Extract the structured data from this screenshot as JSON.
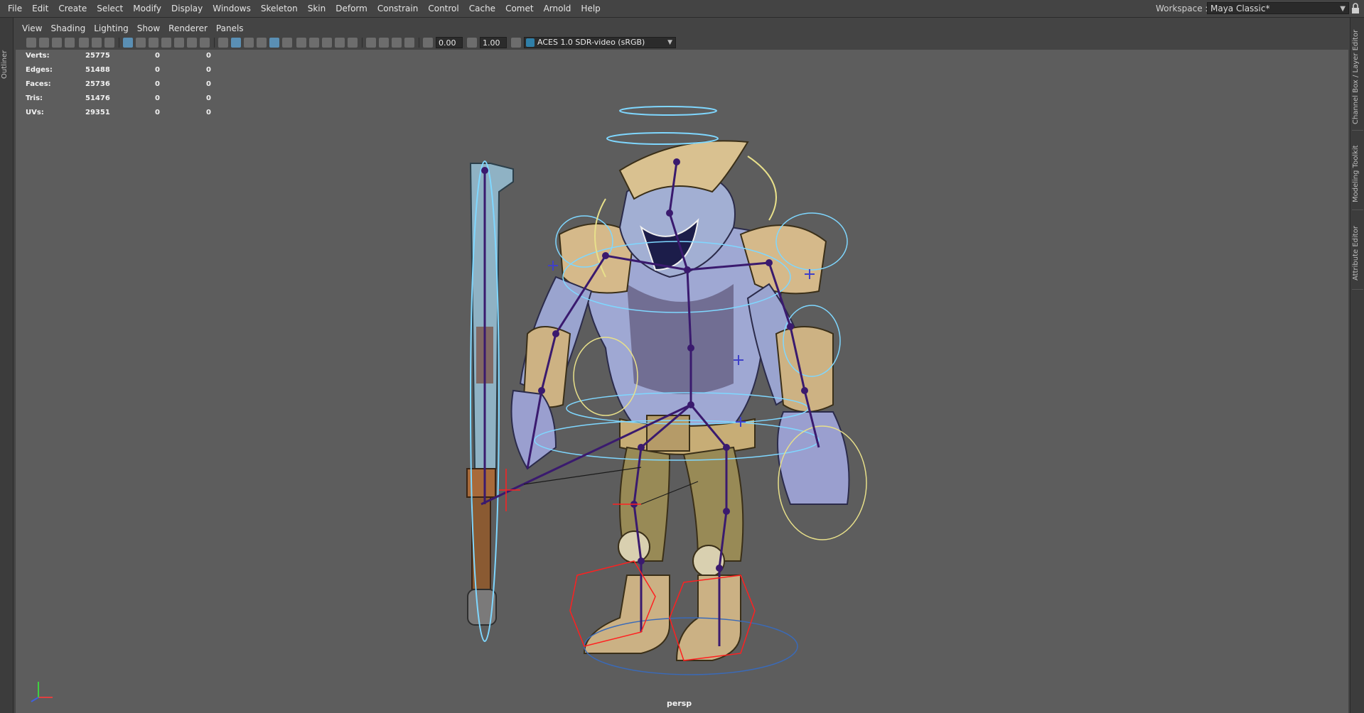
{
  "menubar": {
    "items": [
      "File",
      "Edit",
      "Create",
      "Select",
      "Modify",
      "Display",
      "Windows",
      "Skeleton",
      "Skin",
      "Deform",
      "Constrain",
      "Control",
      "Cache",
      "Comet",
      "Arnold",
      "Help"
    ],
    "workspace_label": "Workspace :",
    "workspace_value": "Maya Classic*"
  },
  "side_panels": {
    "left": [
      "Outliner"
    ],
    "right": [
      "Channel Box / Layer Editor",
      "Modeling Toolkit",
      "Attribute Editor"
    ]
  },
  "panel_menu": [
    "View",
    "Shading",
    "Lighting",
    "Show",
    "Renderer",
    "Panels"
  ],
  "toolbar": {
    "gamma_value": "0.00",
    "exposure_value": "1.00",
    "colorspace": "ACES 1.0 SDR-video (sRGB)"
  },
  "hud": {
    "rows": [
      {
        "label": "Verts:",
        "v1": "25775",
        "v2": "0",
        "v3": "0"
      },
      {
        "label": "Edges:",
        "v1": "51488",
        "v2": "0",
        "v3": "0"
      },
      {
        "label": "Faces:",
        "v1": "25736",
        "v2": "0",
        "v3": "0"
      },
      {
        "label": "Tris:",
        "v1": "51476",
        "v2": "0",
        "v3": "0"
      },
      {
        "label": "UVs:",
        "v1": "29351",
        "v2": "0",
        "v3": "0"
      }
    ]
  },
  "viewport": {
    "camera": "persp",
    "colors": {
      "background": "#5d5d5d",
      "joint": "#3a1a6e",
      "control_curve": "#7fd7ff",
      "ik_handle": "#ff2020",
      "yellow_curve": "#e8e08a"
    }
  }
}
